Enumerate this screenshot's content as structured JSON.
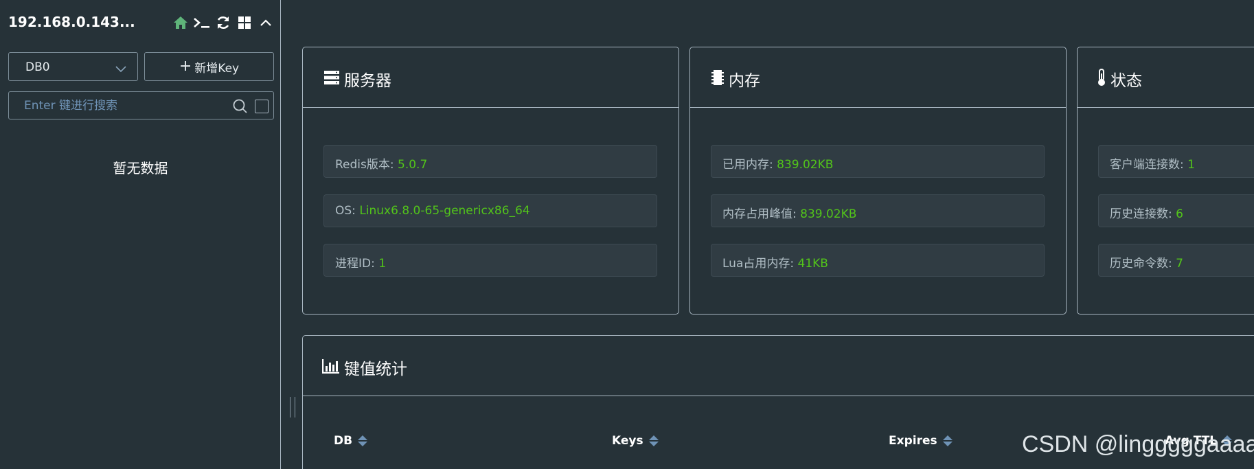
{
  "sidebar": {
    "connection_title": "192.168.0.143...",
    "tools": [
      "home-icon",
      "terminal-icon",
      "refresh-icon",
      "grid-icon",
      "chevron-up-icon"
    ],
    "db_select": {
      "value": "DB0"
    },
    "add_key_label": "新增Key",
    "search": {
      "placeholder": "Enter 键进行搜索",
      "value": ""
    },
    "empty_text": "暂无数据"
  },
  "cards": {
    "server": {
      "title": "服务器",
      "rows": [
        {
          "label": "Redis版本:",
          "value": "5.0.7"
        },
        {
          "label": "OS:",
          "value": "Linux6.8.0-65-genericx86_64"
        },
        {
          "label": "进程ID:",
          "value": "1"
        }
      ]
    },
    "memory": {
      "title": "内存",
      "rows": [
        {
          "label": "已用内存:",
          "value": "839.02KB"
        },
        {
          "label": "内存占用峰值:",
          "value": "839.02KB"
        },
        {
          "label": "Lua占用内存:",
          "value": "41KB"
        }
      ]
    },
    "status": {
      "title": "状态",
      "rows": [
        {
          "label": "客户端连接数:",
          "value": "1"
        },
        {
          "label": "历史连接数:",
          "value": "6"
        },
        {
          "label": "历史命令数:",
          "value": "7"
        }
      ]
    }
  },
  "key_stats": {
    "title": "键值统计",
    "columns": [
      "DB",
      "Keys",
      "Expires",
      "Avg TTL"
    ]
  },
  "colors": {
    "value_green": "#52c41a",
    "home_green": "#5fb47a",
    "accent_blue": "#6f93b6"
  },
  "watermark": "CSDN @lingggggaaaa"
}
